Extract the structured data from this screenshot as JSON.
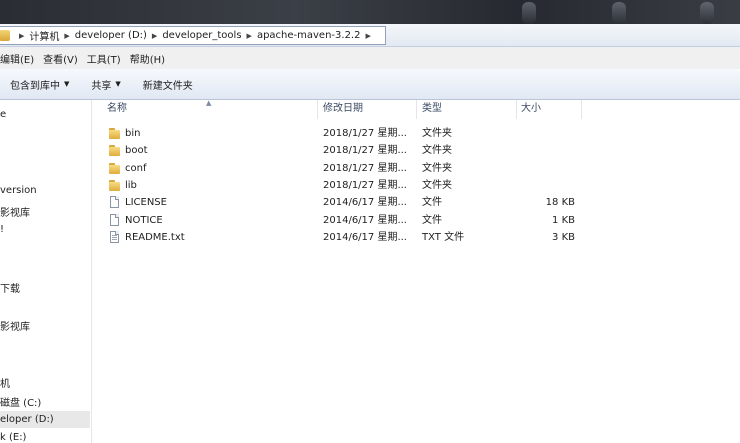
{
  "address": {
    "crumbs": [
      "计算机",
      "developer (D:)",
      "developer_tools",
      "apache-maven-3.2.2"
    ]
  },
  "menu": {
    "items": [
      "编辑(E)",
      "查看(V)",
      "工具(T)",
      "帮助(H)"
    ]
  },
  "toolbar": {
    "include_library": "包含到库中",
    "share": "共享",
    "new_folder": "新建文件夹"
  },
  "sidebar": {
    "items": [
      "e",
      "version",
      "影视库",
      "!",
      "下载",
      "影视库",
      "机",
      "磁盘 (C:)",
      "eloper (D:)",
      "k (E:)"
    ]
  },
  "columns": {
    "name": "名称",
    "modified": "修改日期",
    "type": "类型",
    "size": "大小"
  },
  "files": [
    {
      "name": "bin",
      "modified": "2018/1/27 星期...",
      "type": "文件夹",
      "size": "",
      "icon": "folder-icon"
    },
    {
      "name": "boot",
      "modified": "2018/1/27 星期...",
      "type": "文件夹",
      "size": "",
      "icon": "folder-icon"
    },
    {
      "name": "conf",
      "modified": "2018/1/27 星期...",
      "type": "文件夹",
      "size": "",
      "icon": "folder-icon"
    },
    {
      "name": "lib",
      "modified": "2018/1/27 星期...",
      "type": "文件夹",
      "size": "",
      "icon": "folder-icon"
    },
    {
      "name": "LICENSE",
      "modified": "2014/6/17 星期...",
      "type": "文件",
      "size": "18 KB",
      "icon": "file-icon"
    },
    {
      "name": "NOTICE",
      "modified": "2014/6/17 星期...",
      "type": "文件",
      "size": "1 KB",
      "icon": "file-icon"
    },
    {
      "name": "README.txt",
      "modified": "2014/6/17 星期...",
      "type": "TXT 文件",
      "size": "3 KB",
      "icon": "text-file-icon"
    }
  ],
  "colors": {
    "folder": "#e0ac3d",
    "selection": "#d9e6f5",
    "header_text": "#3a4a63"
  }
}
